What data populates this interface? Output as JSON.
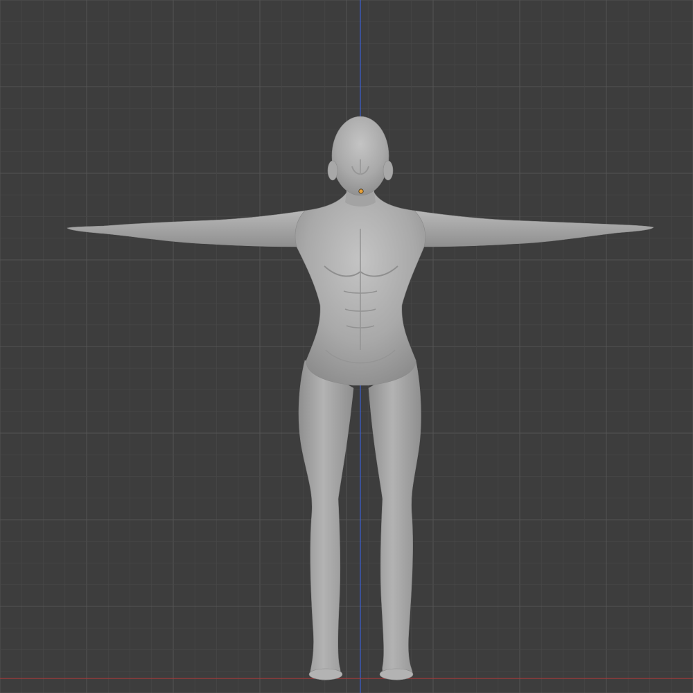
{
  "viewport": {
    "background_color": "#3d3d3d",
    "grid_minor_color": "#474747",
    "grid_major_color": "#545454",
    "axis_z_color": "#3b5fd1",
    "axis_x_color": "#a23b3b"
  },
  "model": {
    "name": "t-pose-body-mesh",
    "fill_color": "#a9a9a9",
    "shadow_color": "#8c8c8c",
    "highlight_color": "#c4c4c4",
    "origin_color": "#e8a23a"
  }
}
